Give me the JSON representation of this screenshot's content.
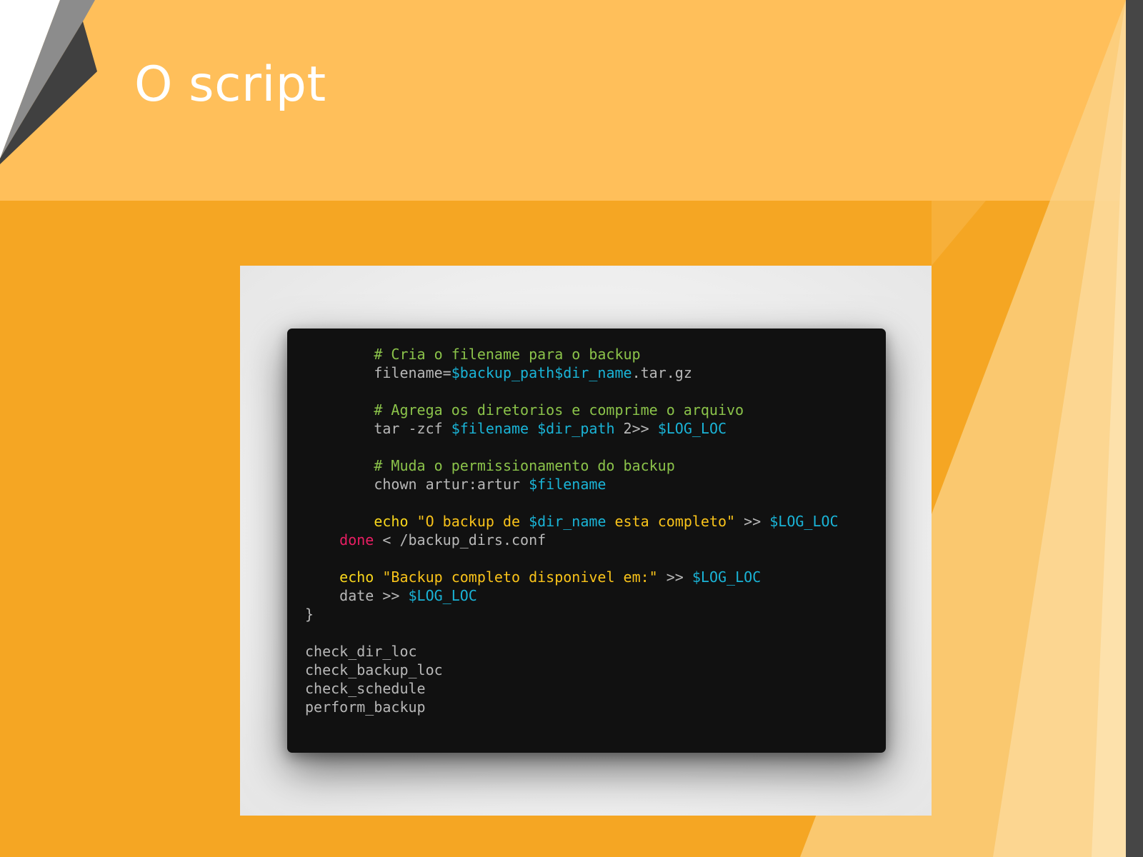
{
  "slide": {
    "title": "O script"
  },
  "colors": {
    "background": "#f5a623",
    "header_band": "#ffbf5a",
    "title_text": "#ffffff",
    "edge_bar": "#464646",
    "terminal_bg": "#111111",
    "comment": "#8bc34a",
    "variable": "#1ab4d7",
    "builtin": "#f9d71c",
    "string": "#f9c31a",
    "keyword": "#e91e63",
    "plain": "#b8b8b8"
  },
  "code_lines": [
    [
      {
        "t": "        "
      },
      {
        "c": "comment",
        "t": "# Cria o filename para o backup"
      }
    ],
    [
      {
        "t": "        filename="
      },
      {
        "c": "var",
        "t": "$backup_path$dir_name"
      },
      {
        "t": ".tar.gz"
      }
    ],
    [],
    [
      {
        "t": "        "
      },
      {
        "c": "comment",
        "t": "# Agrega os diretorios e comprime o arquivo"
      }
    ],
    [
      {
        "t": "        tar -zcf "
      },
      {
        "c": "var",
        "t": "$filename"
      },
      {
        "t": " "
      },
      {
        "c": "var",
        "t": "$dir_path"
      },
      {
        "t": " 2>> "
      },
      {
        "c": "var",
        "t": "$LOG_LOC"
      }
    ],
    [],
    [
      {
        "t": "        "
      },
      {
        "c": "comment",
        "t": "# Muda o permissionamento do backup"
      }
    ],
    [
      {
        "t": "        chown artur:artur "
      },
      {
        "c": "var",
        "t": "$filename"
      }
    ],
    [],
    [
      {
        "t": "        "
      },
      {
        "c": "builtin",
        "t": "echo"
      },
      {
        "t": " "
      },
      {
        "c": "string",
        "t": "\"O backup de "
      },
      {
        "c": "var",
        "t": "$dir_name"
      },
      {
        "c": "string",
        "t": " esta completo\""
      },
      {
        "t": " >> "
      },
      {
        "c": "var",
        "t": "$LOG_LOC"
      }
    ],
    [
      {
        "t": "    "
      },
      {
        "c": "keyword",
        "t": "done"
      },
      {
        "t": " < /backup_dirs.conf"
      }
    ],
    [],
    [
      {
        "t": "    "
      },
      {
        "c": "builtin",
        "t": "echo"
      },
      {
        "t": " "
      },
      {
        "c": "string",
        "t": "\"Backup completo disponivel em:\""
      },
      {
        "t": " >> "
      },
      {
        "c": "var",
        "t": "$LOG_LOC"
      }
    ],
    [
      {
        "t": "    date >> "
      },
      {
        "c": "var",
        "t": "$LOG_LOC"
      }
    ],
    [
      {
        "t": "}"
      }
    ],
    [],
    [
      {
        "t": "check_dir_loc"
      }
    ],
    [
      {
        "t": "check_backup_loc"
      }
    ],
    [
      {
        "t": "check_schedule"
      }
    ],
    [
      {
        "t": "perform_backup"
      }
    ]
  ]
}
